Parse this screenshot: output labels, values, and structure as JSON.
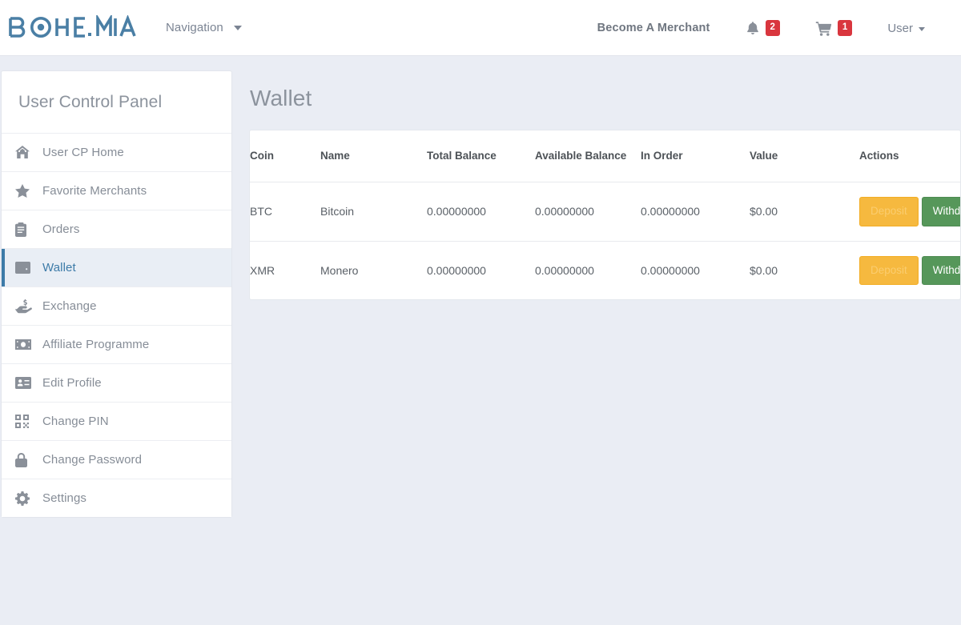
{
  "brand": {
    "name": "BOHEMIA",
    "color": "#4a7fa5"
  },
  "header": {
    "navigation_label": "Navigation",
    "navigation_caret_icon": "chevron-down-icon",
    "merchant_link": "Become A Merchant",
    "notifications": {
      "icon": "bell-icon",
      "count": "2"
    },
    "cart": {
      "icon": "shopping-cart-icon",
      "count": "1"
    },
    "user_menu": {
      "label": "User",
      "caret_icon": "chevron-down-icon"
    },
    "badge_color": "#d9363e"
  },
  "sidebar": {
    "title": "User Control Panel",
    "active_color": "#3d7ba8",
    "items": [
      {
        "label": "User CP Home",
        "icon": "home-icon",
        "active": false
      },
      {
        "label": "Favorite Merchants",
        "icon": "star-icon",
        "active": false
      },
      {
        "label": "Orders",
        "icon": "clipboard-icon",
        "active": false
      },
      {
        "label": "Wallet",
        "icon": "wallet-icon",
        "active": true
      },
      {
        "label": "Exchange",
        "icon": "hand-dollar-icon",
        "active": false
      },
      {
        "label": "Affiliate Programme",
        "icon": "money-bill-icon",
        "active": false
      },
      {
        "label": "Edit Profile",
        "icon": "id-card-icon",
        "active": false
      },
      {
        "label": "Change PIN",
        "icon": "qr-code-icon",
        "active": false
      },
      {
        "label": "Change Password",
        "icon": "lock-icon",
        "active": false
      },
      {
        "label": "Settings",
        "icon": "gear-icon",
        "active": false
      }
    ]
  },
  "main": {
    "page_title": "Wallet",
    "table": {
      "headers": {
        "coin": "Coin",
        "name": "Name",
        "total_balance": "Total Balance",
        "available_balance": "Available Balance",
        "in_order": "In Order",
        "value": "Value",
        "actions": "Actions"
      },
      "rows": [
        {
          "coin": "BTC",
          "name": "Bitcoin",
          "total_balance": "0.00000000",
          "available_balance": "0.00000000",
          "in_order": "0.00000000",
          "value": "$0.00",
          "deposit_label": "Deposit",
          "withdraw_label": "Withdraw"
        },
        {
          "coin": "XMR",
          "name": "Monero",
          "total_balance": "0.00000000",
          "available_balance": "0.00000000",
          "in_order": "0.00000000",
          "value": "$0.00",
          "deposit_label": "Deposit",
          "withdraw_label": "Withdraw"
        }
      ]
    },
    "button_colors": {
      "deposit": "#f6b93f",
      "withdraw": "#56975a"
    }
  }
}
